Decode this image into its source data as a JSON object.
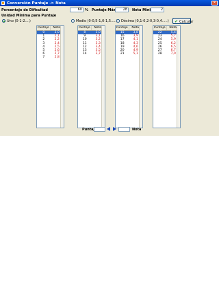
{
  "window": {
    "title": "Conversión Puntaje -> Nota"
  },
  "params": {
    "dificultad_label": "Porcentaje de Dificultad",
    "dificultad_value": "60",
    "dificultad_unit": "%",
    "puntaje_max_label": "Puntaje Máximo",
    "puntaje_max_value": "28",
    "nota_min_label": "Nota Mínima",
    "nota_min_value": "2"
  },
  "unidad": {
    "label": "Unidad Mínima para Puntaje",
    "options": [
      "Uno (0-1-2....)",
      "Medio (0-0,5-1,0-1,5.....)",
      "Décima (0,1-0,2-0,3-0,4.....)"
    ],
    "selected_index": 0
  },
  "calcular_label": "Calcular",
  "columns": [
    {
      "h_puntaje": "Puntaje",
      "h_nota": "Nota",
      "rows": [
        [
          "0",
          "2,0"
        ],
        [
          "1",
          "2,1"
        ],
        [
          "2",
          "2,2"
        ],
        [
          "3",
          "2,4"
        ],
        [
          "4",
          "2,5"
        ],
        [
          "5",
          "2,6"
        ],
        [
          "6",
          "2,7"
        ],
        [
          "7",
          "2,8"
        ]
      ]
    },
    {
      "h_puntaje": "Puntaje",
      "h_nota": "Nota",
      "rows": [
        [
          "8",
          "3,0"
        ],
        [
          "9",
          "3,1"
        ],
        [
          "10",
          "3,2"
        ],
        [
          "11",
          "3,3"
        ],
        [
          "12",
          "3,4"
        ],
        [
          "13",
          "3,5"
        ],
        [
          "14",
          "3,7"
        ]
      ]
    },
    {
      "h_puntaje": "Puntaje",
      "h_nota": "Nota",
      "rows": [
        [
          "15",
          "3,8"
        ],
        [
          "16",
          "3,9"
        ],
        [
          "17",
          "4,1"
        ],
        [
          "18",
          "4,3"
        ],
        [
          "19",
          "4,6"
        ],
        [
          "20",
          "4,9"
        ],
        [
          "21",
          "5,1"
        ]
      ]
    },
    {
      "h_puntaje": "Puntaje",
      "h_nota": "Nota",
      "rows": [
        [
          "22",
          "5,4"
        ],
        [
          "23",
          "5,7"
        ],
        [
          "24",
          "5,9"
        ],
        [
          "25",
          "6,2"
        ],
        [
          "26",
          "6,5"
        ],
        [
          "27",
          "6,7"
        ],
        [
          "28",
          "7,0"
        ]
      ]
    }
  ],
  "bottom": {
    "puntaje_label": "Puntaje",
    "nota_label": "Nota"
  }
}
